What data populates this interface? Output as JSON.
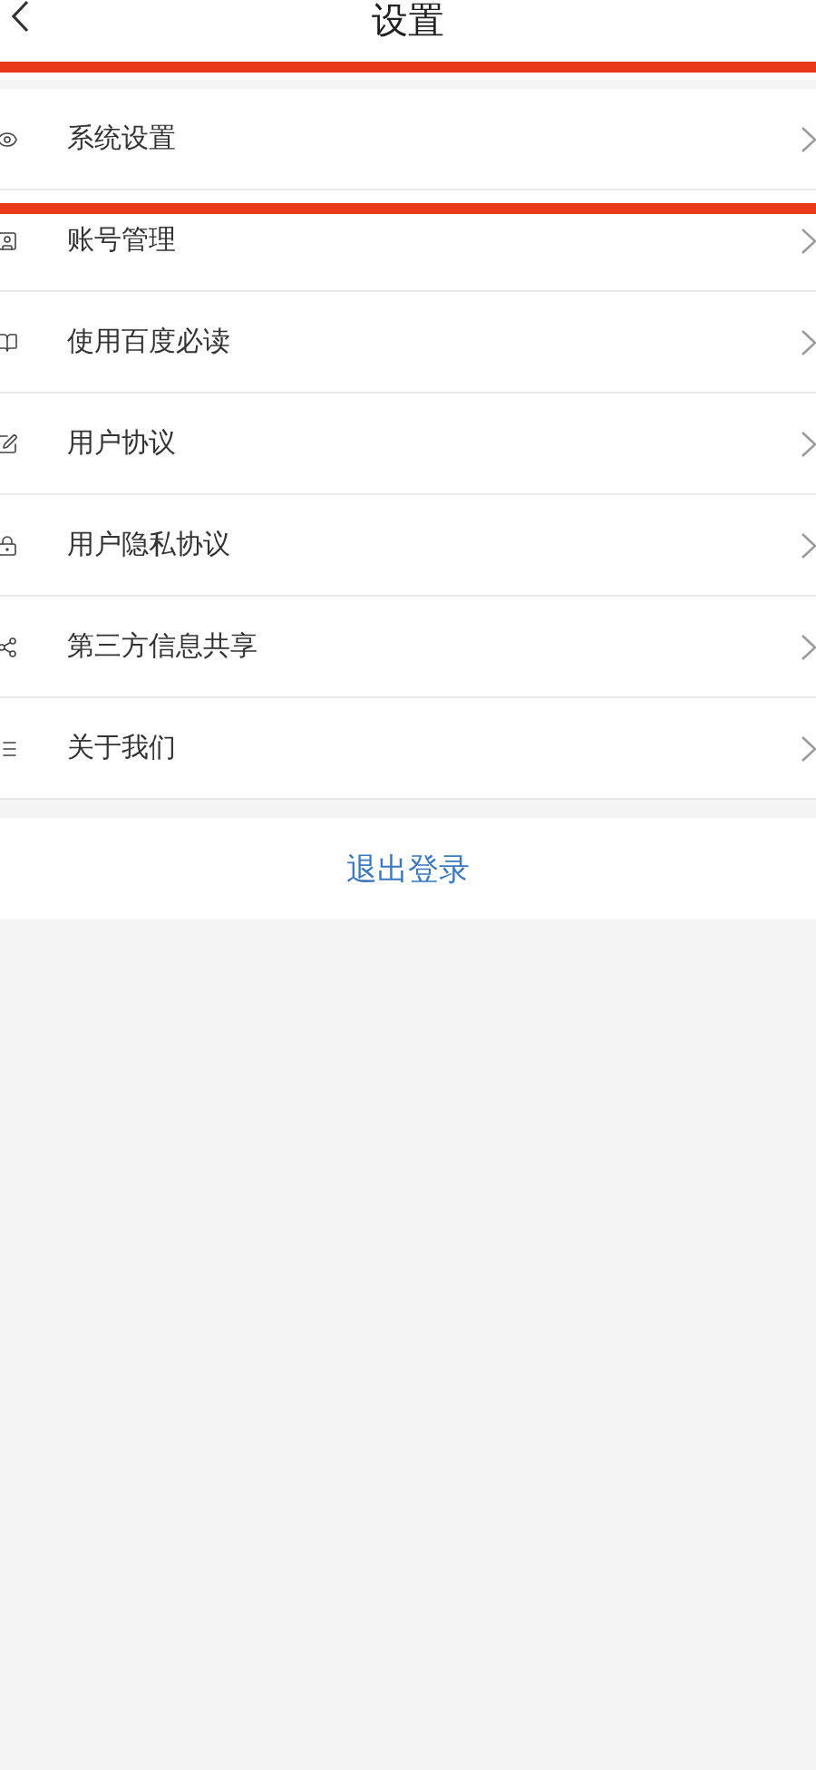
{
  "header": {
    "title": "设置"
  },
  "items": [
    {
      "label": "系统设置",
      "highlighted": true
    },
    {
      "label": "账号管理",
      "highlighted": false
    },
    {
      "label": "使用百度必读",
      "highlighted": false
    },
    {
      "label": "用户协议",
      "highlighted": false
    },
    {
      "label": "用户隐私协议",
      "highlighted": false
    },
    {
      "label": "第三方信息共享",
      "highlighted": false
    },
    {
      "label": "关于我们",
      "highlighted": false
    }
  ],
  "logout": "退出登录"
}
